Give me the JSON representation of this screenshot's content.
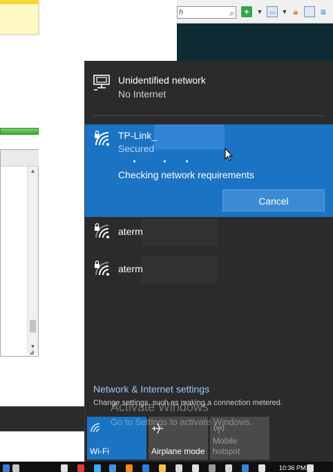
{
  "background_app": {
    "toolbar": {
      "search_text": "h",
      "search_icon": "magnifier-icon",
      "icons": [
        "add-icon",
        "dropdown-icon",
        "page-icon",
        "dropdown-icon",
        "lock-icon",
        "sidebar-icon",
        "menu-icon"
      ]
    }
  },
  "flyout": {
    "networks": [
      {
        "name": "Unidentified network",
        "status": "No Internet",
        "icon": "wired-network-icon"
      },
      {
        "name": "TP-Link_",
        "status": "Secured",
        "progress_text": "Checking network requirements",
        "cancel_label": "Cancel",
        "icon": "wifi-secured-icon",
        "selected": true
      },
      {
        "name": "aterm",
        "icon": "wifi-secured-icon"
      },
      {
        "name": "aterm",
        "icon": "wifi-secured-icon"
      }
    ],
    "settings": {
      "link": "Network & Internet settings",
      "description": "Change settings, such as making a connection metered."
    },
    "quick_actions": [
      {
        "label": "Wi-Fi",
        "icon": "wifi-icon",
        "active": true
      },
      {
        "label": "Airplane mode",
        "icon": "airplane-icon",
        "active": false
      },
      {
        "label": "Mobile hotspot",
        "icon": "hotspot-icon",
        "active": false,
        "disabled": true
      }
    ]
  },
  "watermark": {
    "title": "Activate Windows",
    "subtitle": "Go to Settings to activate Windows."
  },
  "taskbar": {
    "clock": "10:36 PM"
  },
  "colors": {
    "accent": "#1b73c4",
    "flyout_bg": "#2b2b2b",
    "link": "#9ccaf5"
  }
}
